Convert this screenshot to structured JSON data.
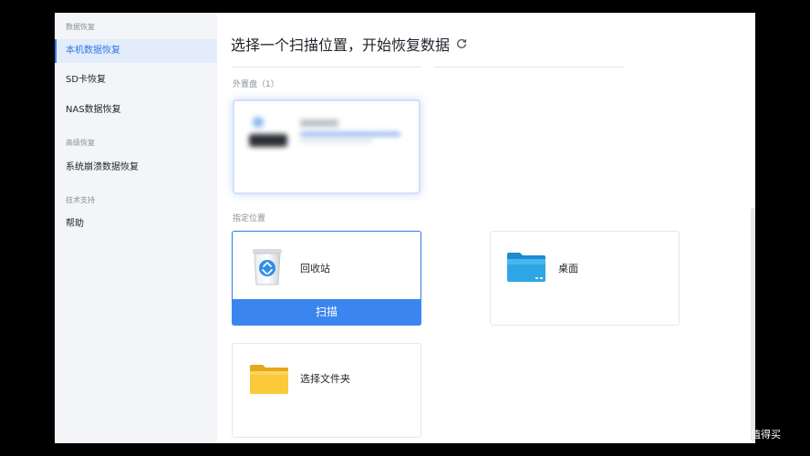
{
  "sidebar": {
    "sections": [
      {
        "title": "数据恢复",
        "items": [
          {
            "label": "本机数据恢复",
            "active": true
          },
          {
            "label": "SD卡恢复"
          },
          {
            "label": "NAS数据恢复"
          }
        ]
      },
      {
        "title": "高级恢复",
        "items": [
          {
            "label": "系统崩溃数据恢复"
          }
        ]
      },
      {
        "title": "技术支持",
        "items": [
          {
            "label": "帮助"
          }
        ]
      }
    ]
  },
  "main": {
    "title": "选择一个扫描位置，开始恢复数据",
    "external_group_label": "外置盘（1）",
    "specified_group_label": "指定位置",
    "locations": [
      {
        "label": "回收站",
        "icon": "recycle-bin-icon",
        "selected": true,
        "action_label": "扫描"
      },
      {
        "label": "桌面",
        "icon": "desktop-folder-icon"
      },
      {
        "label": "选择文件夹",
        "icon": "folder-icon"
      }
    ]
  },
  "watermark": {
    "text": "什么值得买",
    "logo": "值"
  },
  "colors": {
    "accent": "#2f78e6",
    "scan_button": "#3b86ee",
    "sidebar_bg": "#f3f5f8",
    "active_bg": "#e3ecfb"
  }
}
